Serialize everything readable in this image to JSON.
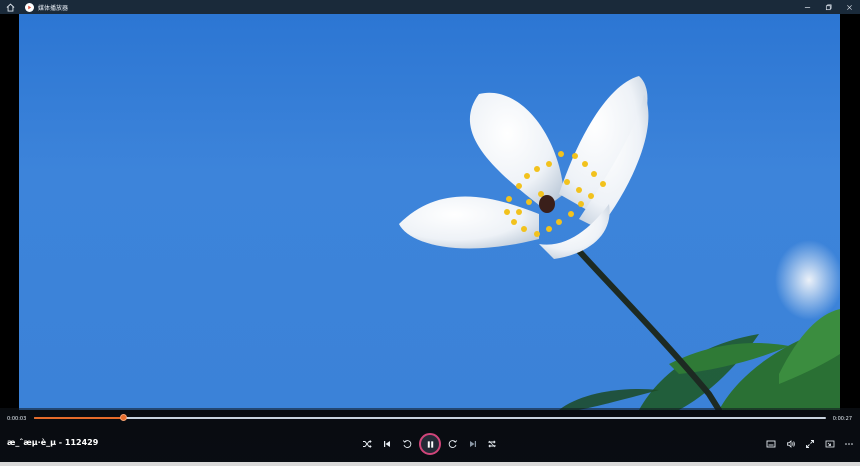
{
  "window": {
    "title": "媒体播放器",
    "buttons": [
      "minimize",
      "maximize",
      "close"
    ]
  },
  "player": {
    "media_title": "æ_ˆæµ·è_µ - 112429",
    "current_time": "0:00:03",
    "total_time": "0:00:27",
    "progress": 0.113,
    "state": "playing"
  },
  "icons": {
    "home": "home-icon",
    "app": "media-player-icon",
    "shuffle": "shuffle-icon",
    "previous": "skip-previous-icon",
    "rewind": "rewind-10-icon",
    "play_pause": "pause-icon",
    "forward": "forward-30-icon",
    "next": "skip-next-icon",
    "repeat": "repeat-icon",
    "captions": "captions-icon",
    "volume": "volume-icon",
    "fullscreen": "fullscreen-icon",
    "miniplayer": "miniplayer-icon",
    "more": "more-icon"
  },
  "colors": {
    "accent": "#e66b2a",
    "play_ring": "#d0457a",
    "titlebar": "#1a2a3a",
    "sky": "#2f78d4"
  }
}
